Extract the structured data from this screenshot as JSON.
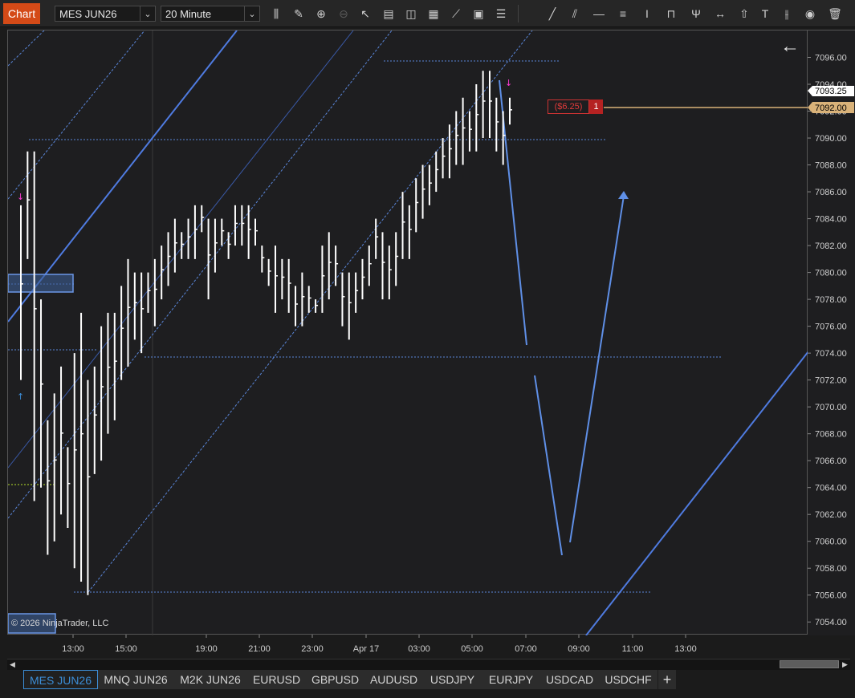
{
  "window": {
    "chart_tab": "Chart",
    "instrument": "MES JUN26",
    "interval": "20 Minute"
  },
  "colors": {
    "accent": "#d44a17",
    "bar": "#ffffff",
    "trendline": "#4f7be0",
    "channel": "#4a78d8",
    "position_line": "#d9b279",
    "loss_text": "#e03a3a",
    "current_price_bg": "#ffffff",
    "active_tab": "#3c8dd6"
  },
  "toolbar_icons": [
    "bar-style-icon",
    "pencil-icon",
    "zoom-in-icon",
    "zoom-out-icon",
    "pointer-icon",
    "data-box-icon",
    "templates-icon",
    "indicators-icon",
    "strategies-icon",
    "properties-icon",
    "list-icon",
    "line-icon",
    "ray-icon",
    "horizontal-line-icon",
    "horizontal-lines-icon",
    "vertical-line-icon",
    "ruler-icon",
    "pitchfork-icon",
    "arrow-line-icon",
    "arrow-up-icon",
    "text-icon",
    "fibonacci-icon",
    "hide-drawings-icon",
    "trash-icon"
  ],
  "price_axis": {
    "ticks": [
      "7096.00",
      "7094.00",
      "7092.00",
      "7090.00",
      "7088.00",
      "7086.00",
      "7084.00",
      "7082.00",
      "7080.00",
      "7078.00",
      "7076.00",
      "7074.00",
      "7072.00",
      "7070.00",
      "7068.00",
      "7066.00",
      "7064.00",
      "7062.00",
      "7060.00",
      "7058.00",
      "7056.00",
      "7054.00"
    ],
    "current_price": "7093.25",
    "position_price": "7092.00"
  },
  "time_axis": {
    "ticks": [
      "13:00",
      "15:00",
      "19:00",
      "21:00",
      "23:00",
      "Apr 17",
      "03:00",
      "05:00",
      "07:00",
      "09:00",
      "11:00",
      "13:00"
    ]
  },
  "position": {
    "pnl": "($6.25)",
    "quantity": "1"
  },
  "chart": {
    "back_arrow": "←",
    "copyright": "© 2026 NinjaTrader, LLC"
  },
  "chart_data": {
    "type": "ohlc",
    "instrument": "MES JUN26",
    "interval": "20 Minute",
    "ylim": [
      7053,
      7098
    ],
    "bars": [
      [
        7085,
        7072
      ],
      [
        7089,
        7081
      ],
      [
        7089,
        7063
      ],
      [
        7078,
        7064
      ],
      [
        7069,
        7059
      ],
      [
        7071,
        7060
      ],
      [
        7073,
        7062
      ],
      [
        7067,
        7061
      ],
      [
        7074,
        7058
      ],
      [
        7077,
        7057
      ],
      [
        7072,
        7056
      ],
      [
        7073,
        7065
      ],
      [
        7076,
        7066
      ],
      [
        7077,
        7068
      ],
      [
        7077,
        7069
      ],
      [
        7079,
        7072
      ],
      [
        7081,
        7073
      ],
      [
        7080,
        7075
      ],
      [
        7080,
        7074
      ],
      [
        7080,
        7077
      ],
      [
        7081,
        7076
      ],
      [
        7082,
        7078
      ],
      [
        7083,
        7079
      ],
      [
        7084,
        7080
      ],
      [
        7083,
        7081
      ],
      [
        7084,
        7081
      ],
      [
        7085,
        7081
      ],
      [
        7085,
        7083
      ],
      [
        7084,
        7078
      ],
      [
        7084,
        7080
      ],
      [
        7084,
        7082
      ],
      [
        7083,
        7081
      ],
      [
        7085,
        7082
      ],
      [
        7085,
        7082
      ],
      [
        7085,
        7081
      ],
      [
        7084,
        7082
      ],
      [
        7082,
        7080
      ],
      [
        7081,
        7079
      ],
      [
        7082,
        7077
      ],
      [
        7081,
        7078
      ],
      [
        7081,
        7077
      ],
      [
        7079,
        7076
      ],
      [
        7080,
        7076
      ],
      [
        7079,
        7077
      ],
      [
        7078,
        7077
      ],
      [
        7082,
        7077
      ],
      [
        7083,
        7078
      ],
      [
        7082,
        7079
      ],
      [
        7080,
        7076
      ],
      [
        7080,
        7075
      ],
      [
        7080,
        7077
      ],
      [
        7081,
        7078
      ],
      [
        7082,
        7079
      ],
      [
        7084,
        7081
      ],
      [
        7083,
        7078
      ],
      [
        7082,
        7078
      ],
      [
        7083,
        7079
      ],
      [
        7086,
        7081
      ],
      [
        7085,
        7081
      ],
      [
        7087,
        7083
      ],
      [
        7088,
        7084
      ],
      [
        7088,
        7085
      ],
      [
        7089,
        7086
      ],
      [
        7090,
        7087
      ],
      [
        7091,
        7087
      ],
      [
        7092,
        7088
      ],
      [
        7093,
        7088
      ],
      [
        7092,
        7089
      ],
      [
        7094,
        7089
      ],
      [
        7095,
        7090
      ],
      [
        7095,
        7090
      ],
      [
        7093,
        7089
      ],
      [
        7092,
        7088
      ],
      [
        7093,
        7091
      ]
    ]
  }
}
